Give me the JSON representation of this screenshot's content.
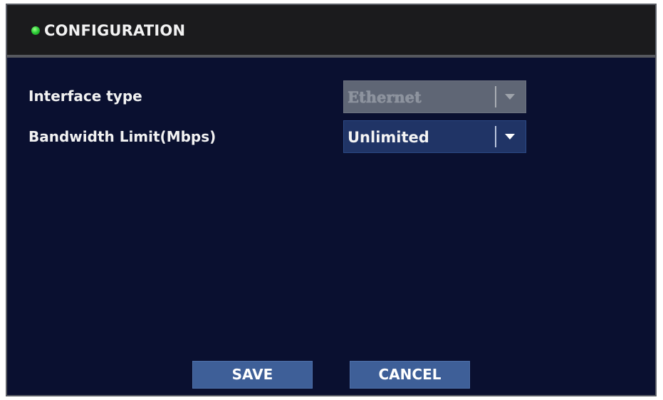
{
  "window": {
    "title": "CONFIGURATION",
    "status_color": "#2fd13a"
  },
  "form": {
    "rows": [
      {
        "label": "Interface type",
        "value": "Ethernet",
        "enabled": false,
        "icon": "chevron-down-icon"
      },
      {
        "label": "Bandwidth Limit(Mbps)",
        "value": "Unlimited",
        "enabled": true,
        "icon": "chevron-down-icon"
      }
    ]
  },
  "actions": {
    "save_label": "SAVE",
    "cancel_label": "CANCEL"
  },
  "colors": {
    "background": "#0a1030",
    "titlebar": "#1b1b1d",
    "select_bg": "#203466",
    "select_disabled_bg": "#5f6675",
    "button_bg": "#3e5f98"
  }
}
